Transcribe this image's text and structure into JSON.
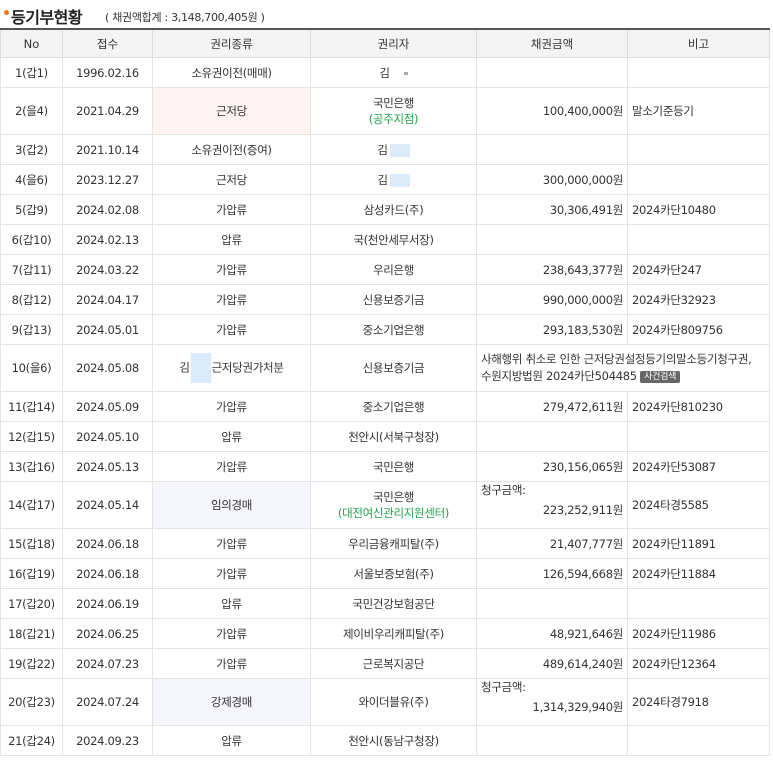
{
  "header": {
    "bullet": "•",
    "title": "등기부현황",
    "subtitle": "( 채권액합계 : 3,148,700,405원 )"
  },
  "columns": [
    "No",
    "접수",
    "권리종류",
    "권리자",
    "채권금액",
    "비고"
  ],
  "rows": [
    {
      "no": "1(갑1)",
      "date": "1996.02.16",
      "type": "소유권이전(매매)",
      "holder": "김",
      "holder2": "",
      "amount": "",
      "note": ""
    },
    {
      "no": "2(을4)",
      "date": "2021.04.29",
      "type": "근저당",
      "holder": "국민은행",
      "holder2": "(공주지점)",
      "amount": "100,400,000원",
      "note": "말소기준등기"
    },
    {
      "no": "3(갑2)",
      "date": "2021.10.14",
      "type": "소유권이전(증여)",
      "holder": "김",
      "holder2": "",
      "amount": "",
      "note": ""
    },
    {
      "no": "4(을6)",
      "date": "2023.12.27",
      "type": "근저당",
      "holder": "김",
      "holder2": "",
      "amount": "300,000,000원",
      "note": ""
    },
    {
      "no": "5(갑9)",
      "date": "2024.02.08",
      "type": "가압류",
      "holder": "삼성카드(주)",
      "holder2": "",
      "amount": "30,306,491원",
      "note": "2024카단10480"
    },
    {
      "no": "6(갑10)",
      "date": "2024.02.13",
      "type": "압류",
      "holder": "국(천안세무서장)",
      "holder2": "",
      "amount": "",
      "note": ""
    },
    {
      "no": "7(갑11)",
      "date": "2024.03.22",
      "type": "가압류",
      "holder": "우리은행",
      "holder2": "",
      "amount": "238,643,377원",
      "note": "2024카단247"
    },
    {
      "no": "8(갑12)",
      "date": "2024.04.17",
      "type": "가압류",
      "holder": "신용보증기금",
      "holder2": "",
      "amount": "990,000,000원",
      "note": "2024카단32923"
    },
    {
      "no": "9(갑13)",
      "date": "2024.05.01",
      "type": "가압류",
      "holder": "중소기업은행",
      "holder2": "",
      "amount": "293,183,530원",
      "note": "2024카단809756"
    },
    {
      "no": "10(을6)",
      "date": "2024.05.08",
      "type_prefix": "김",
      "type": "근저당권가처분",
      "holder": "신용보증기금",
      "holder2": "",
      "amount": "",
      "note": "사해행위 취소로 인한 근저당권설정등기의말소등기청구권, 수원지방법원 2024카단504485",
      "badge": "사건검색"
    },
    {
      "no": "11(갑14)",
      "date": "2024.05.09",
      "type": "가압류",
      "holder": "중소기업은행",
      "holder2": "",
      "amount": "279,472,611원",
      "note": "2024카단810230"
    },
    {
      "no": "12(갑15)",
      "date": "2024.05.10",
      "type": "압류",
      "holder": "천안시(서북구청장)",
      "holder2": "",
      "amount": "",
      "note": ""
    },
    {
      "no": "13(갑16)",
      "date": "2024.05.13",
      "type": "가압류",
      "holder": "국민은행",
      "holder2": "",
      "amount": "230,156,065원",
      "note": "2024카단53087"
    },
    {
      "no": "14(갑17)",
      "date": "2024.05.14",
      "type": "임의경매",
      "holder": "국민은행",
      "holder2": "(대전여신관리지원센터)",
      "amount_label": "청구금액:",
      "amount": "223,252,911원",
      "note": "2024타경5585"
    },
    {
      "no": "15(갑18)",
      "date": "2024.06.18",
      "type": "가압류",
      "holder": "우리금융캐피탈(주)",
      "holder2": "",
      "amount": "21,407,777원",
      "note": "2024카단11891"
    },
    {
      "no": "16(갑19)",
      "date": "2024.06.18",
      "type": "가압류",
      "holder": "서울보증보험(주)",
      "holder2": "",
      "amount": "126,594,668원",
      "note": "2024카단11884"
    },
    {
      "no": "17(갑20)",
      "date": "2024.06.19",
      "type": "압류",
      "holder": "국민건강보험공단",
      "holder2": "",
      "amount": "",
      "note": ""
    },
    {
      "no": "18(갑21)",
      "date": "2024.06.25",
      "type": "가압류",
      "holder": "제이비우리캐피탈(주)",
      "holder2": "",
      "amount": "48,921,646원",
      "note": "2024카단11986"
    },
    {
      "no": "19(갑22)",
      "date": "2024.07.23",
      "type": "가압류",
      "holder": "근로복지공단",
      "holder2": "",
      "amount": "489,614,240원",
      "note": "2024카단12364"
    },
    {
      "no": "20(갑23)",
      "date": "2024.07.24",
      "type": "강제경매",
      "holder": "와이더블유(주)",
      "holder2": "",
      "amount_label": "청구금액:",
      "amount": "1,314,329,940원",
      "note": "2024타경7918"
    },
    {
      "no": "21(갑24)",
      "date": "2024.09.23",
      "type": "압류",
      "holder": "천안시(동남구청장)",
      "holder2": "",
      "amount": "",
      "note": ""
    }
  ]
}
